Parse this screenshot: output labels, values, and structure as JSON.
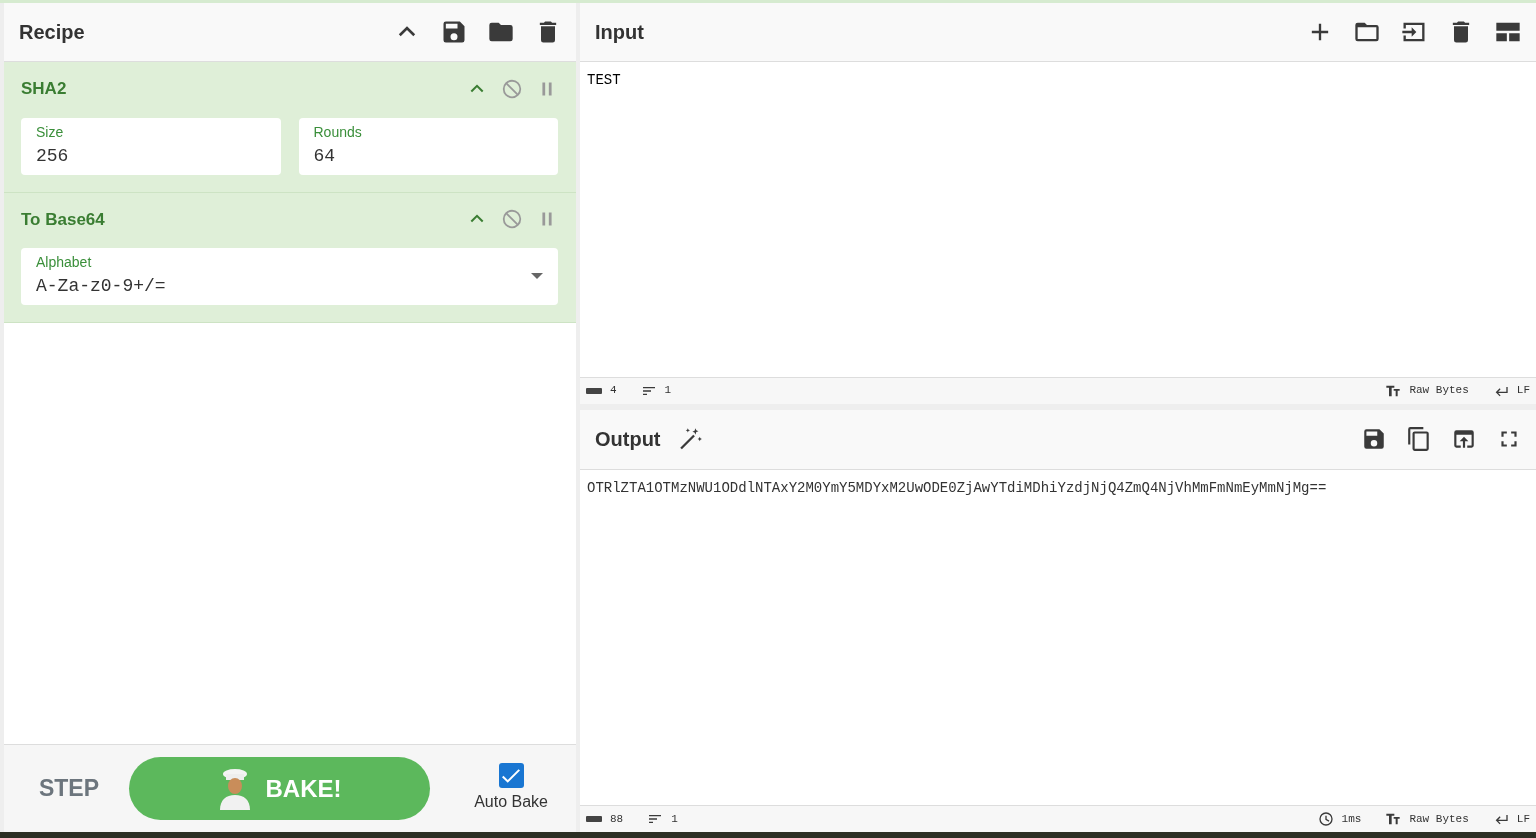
{
  "recipe": {
    "title": "Recipe",
    "operations": [
      {
        "name": "SHA2",
        "args": [
          {
            "kind": "text",
            "label": "Size",
            "value": "256"
          },
          {
            "kind": "text",
            "label": "Rounds",
            "value": "64"
          }
        ]
      },
      {
        "name": "To Base64",
        "args": [
          {
            "kind": "dropdown",
            "label": "Alphabet",
            "value": "A-Za-z0-9+/="
          }
        ]
      }
    ],
    "step": "STEP",
    "bake": "BAKE!",
    "auto_bake": {
      "label": "Auto Bake",
      "checked": true
    }
  },
  "input": {
    "title": "Input",
    "text": "TEST",
    "length": "4",
    "lines": "1",
    "encoding": "Raw Bytes",
    "eol": "LF"
  },
  "output": {
    "title": "Output",
    "text": "OTRlZTA1OTMzNWU1ODdlNTAxY2M0YmY5MDYxM2UwODE0ZjAwYTdiMDhiYzdjNjQ4ZmQ4NjVhMmFmNmEyMmNjMg==",
    "length": "88",
    "lines": "1",
    "time": "1ms",
    "encoding": "Raw Bytes",
    "eol": "LF"
  }
}
